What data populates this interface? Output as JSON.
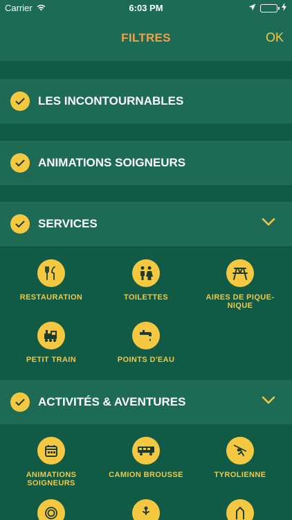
{
  "status_bar": {
    "carrier": "Carrier",
    "time": "6:03 PM"
  },
  "header": {
    "title": "FILTRES",
    "ok_label": "OK"
  },
  "filters": [
    {
      "label": "LES INCONTOURNABLES",
      "checked": true
    },
    {
      "label": "ANIMATIONS SOIGNEURS",
      "checked": true
    },
    {
      "label": "SERVICES",
      "checked": true,
      "expanded": true,
      "items": [
        {
          "label": "RESTAURATION",
          "icon": "restaurant-icon"
        },
        {
          "label": "TOILETTES",
          "icon": "toilets-icon"
        },
        {
          "label": "AIRES DE PIQUE-NIQUE",
          "icon": "picnic-table-icon"
        },
        {
          "label": "PETIT TRAIN",
          "icon": "train-icon"
        },
        {
          "label": "POINTS D'EAU",
          "icon": "water-tap-icon"
        }
      ]
    },
    {
      "label": "ACTIVITÉS & AVENTURES",
      "checked": true,
      "expanded": true,
      "items": [
        {
          "label": "ANIMATIONS SOIGNEURS",
          "icon": "calendar-icon"
        },
        {
          "label": "CAMION BROUSSE",
          "icon": "bus-icon"
        },
        {
          "label": "TYROLIENNE",
          "icon": "zipline-icon"
        },
        {
          "label": "",
          "icon": "maze-icon"
        },
        {
          "label": "",
          "icon": "trampoline-icon"
        },
        {
          "label": "",
          "icon": "playground-icon"
        }
      ]
    }
  ],
  "colors": {
    "accent": "#f5c842",
    "title": "#f0a14a",
    "row_bg": "#1d6b55",
    "page_bg": "#115a45"
  }
}
